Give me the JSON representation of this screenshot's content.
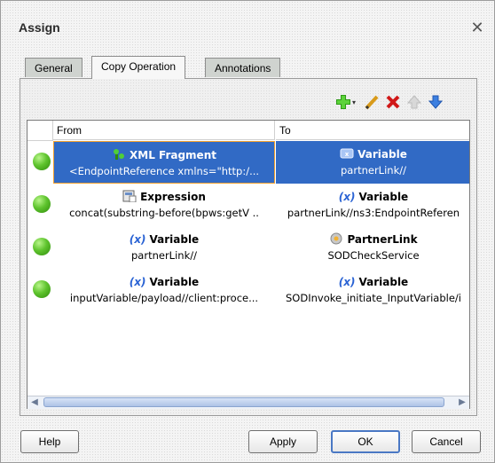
{
  "dialog": {
    "title": "Assign"
  },
  "tabs": [
    {
      "label": "General",
      "active": false
    },
    {
      "label": "Copy Operation",
      "active": true
    },
    {
      "label": "Annotations",
      "active": false
    }
  ],
  "toolbar": {
    "add_icon": "add-icon",
    "edit_icon": "pencil-icon",
    "delete_icon": "delete-icon",
    "up_icon": "arrow-up-icon",
    "down_icon": "arrow-down-icon"
  },
  "table": {
    "columns": {
      "from": "From",
      "to": "To"
    },
    "rows": [
      {
        "from_type": "XML Fragment",
        "from_value": "<EndpointReference xmlns=\"http:/...",
        "to_type": "Variable",
        "to_value": "partnerLink//",
        "selected": true
      },
      {
        "from_type": "Expression",
        "from_value": "concat(substring-before(bpws:getV ..",
        "to_type": "Variable",
        "to_value": "partnerLink//ns3:EndpointReferen",
        "selected": false
      },
      {
        "from_type": "Variable",
        "from_value": "partnerLink//",
        "to_type": "PartnerLink",
        "to_value": "SODCheckService",
        "selected": false
      },
      {
        "from_type": "Variable",
        "from_value": "inputVariable/payload//client:proce...",
        "to_type": "Variable",
        "to_value": "SODInvoke_initiate_InputVariable/i",
        "selected": false
      }
    ]
  },
  "buttons": {
    "help": "Help",
    "apply": "Apply",
    "ok": "OK",
    "cancel": "Cancel"
  },
  "xvar_glyph": "(x)",
  "colors": {
    "selection": "#316ac5",
    "status_ok": "#5fc42e",
    "toolbar_add": "#2e9a16",
    "toolbar_delete": "#d01818"
  }
}
